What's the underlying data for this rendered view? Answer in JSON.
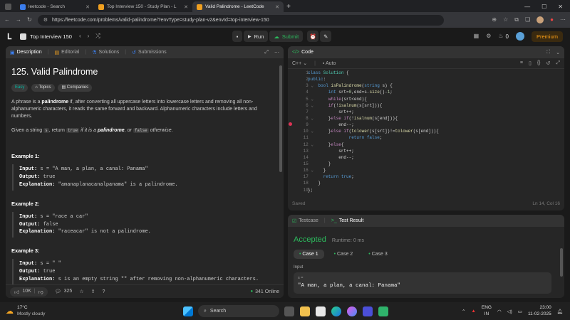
{
  "browser": {
    "tabs": [
      {
        "label": "leetcode - Search",
        "color": "#3b7ded"
      },
      {
        "label": "Top Interview 150 - Study Plan - L",
        "color": "#f0a020"
      },
      {
        "label": "Valid Palindrome - LeetCode",
        "color": "#f0a020"
      }
    ],
    "url": "https://leetcode.com/problems/valid-palindrome/?envType=study-plan-v2&envId=top-interview-150"
  },
  "lcnav": {
    "study_plan": "Top Interview 150",
    "run_label": "Run",
    "submit_label": "Submit",
    "streak": "0",
    "premium_label": "Premium"
  },
  "left": {
    "tabs": [
      "Description",
      "Editorial",
      "Solutions",
      "Submissions"
    ],
    "title": "125. Valid Palindrome",
    "pills": [
      "Easy",
      "Topics",
      "Companies"
    ],
    "para1_pre": "A phrase is a ",
    "para1_bold": "palindrome",
    "para1_post": " if, after converting all uppercase letters into lowercase letters and removing all non-alphanumeric characters, it reads the same forward and backward. Alphanumeric characters include letters and numbers.",
    "para2_a": "Given a string ",
    "para2_s": "s",
    "para2_b": ", return ",
    "para2_true": "true",
    "para2_c": " if it is a ",
    "para2_pal": "palindrome",
    "para2_d": ", or ",
    "para2_false": "false",
    "para2_e": " otherwise.",
    "examples": [
      {
        "h": "Example 1:",
        "input": "s = \"A man, a plan, a canal: Panama\"",
        "output": "true",
        "expl": "\"amanaplanacanalpanama\" is a palindrome."
      },
      {
        "h": "Example 2:",
        "input": "s = \"race a car\"",
        "output": "false",
        "expl": "\"raceacar\" is not a palindrome."
      },
      {
        "h": "Example 3:",
        "input": "s = \" \"",
        "output": "true",
        "expl": "s is an empty string \"\" after removing non-alphanumeric characters."
      }
    ],
    "kw_input": "Input:",
    "kw_output": "Output:",
    "kw_expl": "Explanation:",
    "likes": "10K",
    "comments": "325",
    "online": "341 Online"
  },
  "code": {
    "title": "Code",
    "lang": "C++",
    "auto": "Auto",
    "status_left": "Saved",
    "status_right": "Ln 14, Col 16",
    "lines": [
      "class Solution {",
      "public:",
      "    bool isPalindrome(string s) {",
      "        int srt=0,end=s.size()-1;",
      "        while(srt<end){",
      "        if(!isalnum(s[srt])){",
      "            srt++;",
      "        }else if(!isalnum(s[end])){",
      "            end--;",
      "        }else if(tolower(s[srt])!=tolower(s[end])){",
      "                return false;",
      "        }else{",
      "            srt++;",
      "            end--;",
      "        }",
      "      }",
      "      return true;",
      "    }",
      "};"
    ]
  },
  "result": {
    "tabs": [
      "Testcase",
      "Test Result"
    ],
    "accepted": "Accepted",
    "runtime": "Runtime: 0 ms",
    "cases": [
      "Case 1",
      "Case 2",
      "Case 3"
    ],
    "input_label": "Input",
    "var": "s =",
    "value": "\"A man, a plan, a canal: Panama\""
  },
  "taskbar": {
    "temp": "17°C",
    "weather": "Mostly cloudy",
    "search": "Search",
    "lang1": "ENG",
    "lang2": "IN",
    "time": "23:00",
    "date": "11-02-2025"
  }
}
